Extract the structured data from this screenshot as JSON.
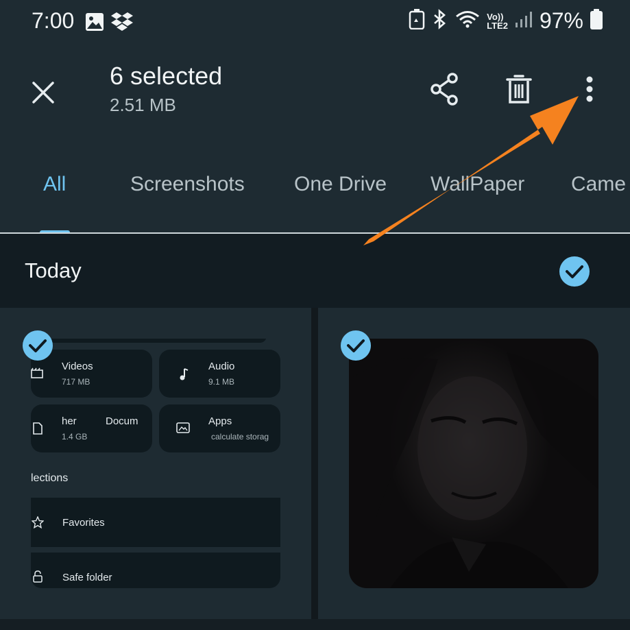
{
  "status_bar": {
    "time": "7:00",
    "network": "LTE2",
    "volte": "Vo))",
    "battery": "97%"
  },
  "app_bar": {
    "title": "6 selected",
    "subtitle": "2.51 MB",
    "actions": [
      "share-icon",
      "delete-icon",
      "more-options-icon"
    ]
  },
  "tabs": [
    {
      "label": "All",
      "active": true
    },
    {
      "label": "Screenshots",
      "active": false
    },
    {
      "label": "One Drive",
      "active": false
    },
    {
      "label": "WallPaper",
      "active": false
    },
    {
      "label": "Came",
      "active": false
    }
  ],
  "section": {
    "title": "Today",
    "all_selected": true
  },
  "thumbnails": [
    {
      "selected": true,
      "content": {
        "cards": [
          {
            "title": "Videos",
            "sub": "717 MB",
            "icon": "clapperboard-icon"
          },
          {
            "title": "Audio",
            "sub": "9.1 MB",
            "icon": "music-note-icon"
          },
          {
            "title": "her",
            "title2": "Docum",
            "sub": "1.4 GB",
            "icon": "document-icon"
          },
          {
            "title": "Apps",
            "sub": "calculate storag",
            "icon": "apps-icon"
          }
        ],
        "heading": "lections",
        "rows": [
          {
            "label": "Favorites",
            "icon": "star-icon"
          },
          {
            "label": "Safe folder",
            "icon": "lock-icon"
          }
        ]
      }
    },
    {
      "selected": true,
      "content": "dark portrait photo"
    }
  ],
  "annotation": {
    "arrow_color": "#f5821f"
  }
}
